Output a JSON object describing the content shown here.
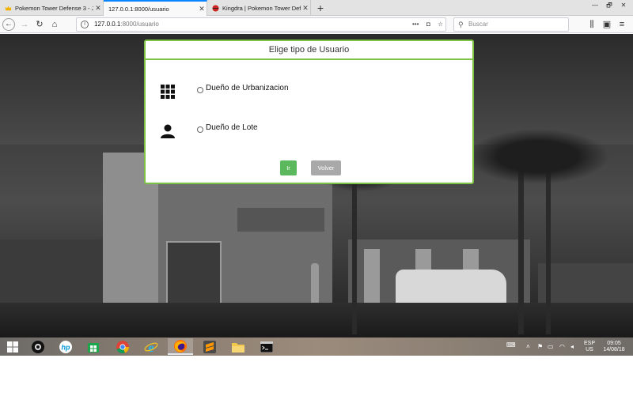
{
  "browser": {
    "tabs": [
      {
        "title": "Pokemon Tower Defense 3 - Ju",
        "active": false
      },
      {
        "title": "127.0.0.1:8000/usuario",
        "active": true
      },
      {
        "title": "Kingdra | Pokemon Tower Defe",
        "active": false
      }
    ],
    "url_host": "127.0.0.1",
    "url_path": ":8000/usuario",
    "search_placeholder": "Buscar",
    "window_controls": {
      "minimize": "—",
      "restore": "🗗",
      "close": "✕"
    }
  },
  "modal": {
    "title": "Elige tipo de Usuario",
    "options": [
      {
        "label": "Dueño de Urbanizacion",
        "icon": "grid-icon"
      },
      {
        "label": "Dueño de Lote",
        "icon": "user-icon"
      }
    ],
    "btn_ir": "Ir",
    "btn_volver": "Volver"
  },
  "taskbar": {
    "apps": [
      "start-menu",
      "webcam",
      "hp",
      "store",
      "chrome",
      "internet-explorer",
      "firefox",
      "sublime-text",
      "file-explorer",
      "command-prompt"
    ],
    "lang_top": "ESP",
    "lang_bottom": "US",
    "time": "09:05",
    "date": "14/08/18"
  },
  "colors": {
    "accent_green": "#7dc242",
    "btn_ir": "#5cb85c",
    "btn_volver": "#a9a9a9",
    "firefox_tab_blue": "#0a84ff"
  }
}
